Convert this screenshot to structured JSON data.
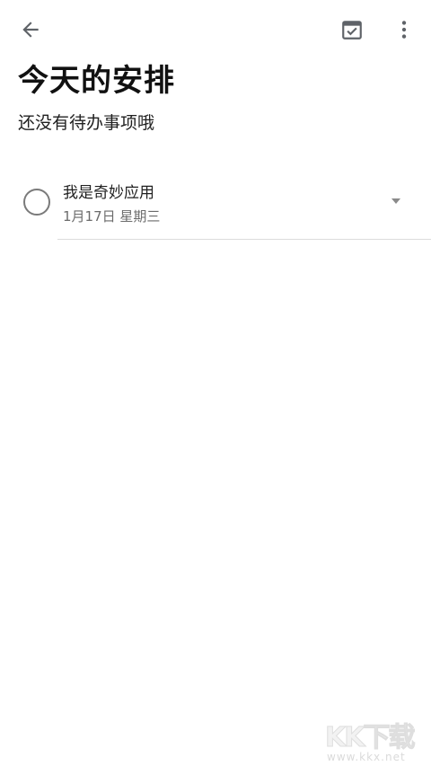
{
  "toolbar": {
    "back_icon": "arrow-left-icon",
    "calendar_icon": "calendar-check-icon",
    "more_icon": "more-vertical-icon",
    "icon_color": "#5f6368"
  },
  "header": {
    "title": "今天的安排",
    "subtitle": "还没有待办事项哦"
  },
  "tasks": [
    {
      "title": "我是奇妙应用",
      "date": "1月17日 星期三",
      "completed": false,
      "expand_icon": "caret-down-icon"
    }
  ],
  "watermark": {
    "logo": "KK下载",
    "url": "www.kkx.net"
  }
}
